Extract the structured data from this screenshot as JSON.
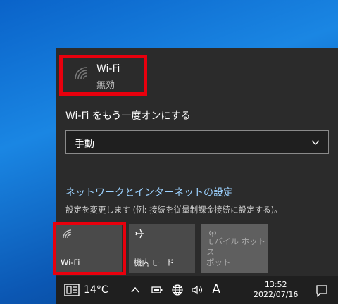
{
  "network": {
    "name": "Wi-Fi",
    "status": "無効"
  },
  "turn_on_label": "Wi-Fi をもう一度オンにする",
  "turn_on_select": {
    "selected": "手動"
  },
  "settings_link": "ネットワークとインターネットの設定",
  "settings_description": "設定を変更します (例: 接続を従量制課金接続に設定する)。",
  "quick_actions": [
    {
      "label": "Wi-Fi",
      "icon": "wifi-icon",
      "state": "off"
    },
    {
      "label": "機内モード",
      "icon": "airplane-icon",
      "state": "off"
    },
    {
      "label": "モバイル ホットス\nポット",
      "icon": "hotspot-icon",
      "state": "disabled"
    }
  ],
  "taskbar": {
    "weather_temp": "14°C",
    "input_mode": "A",
    "time": "13:52",
    "date": "2022/07/16"
  },
  "colors": {
    "highlight": "#e8000d",
    "link": "#9cd2ff",
    "panel": "#2b2b2b"
  }
}
